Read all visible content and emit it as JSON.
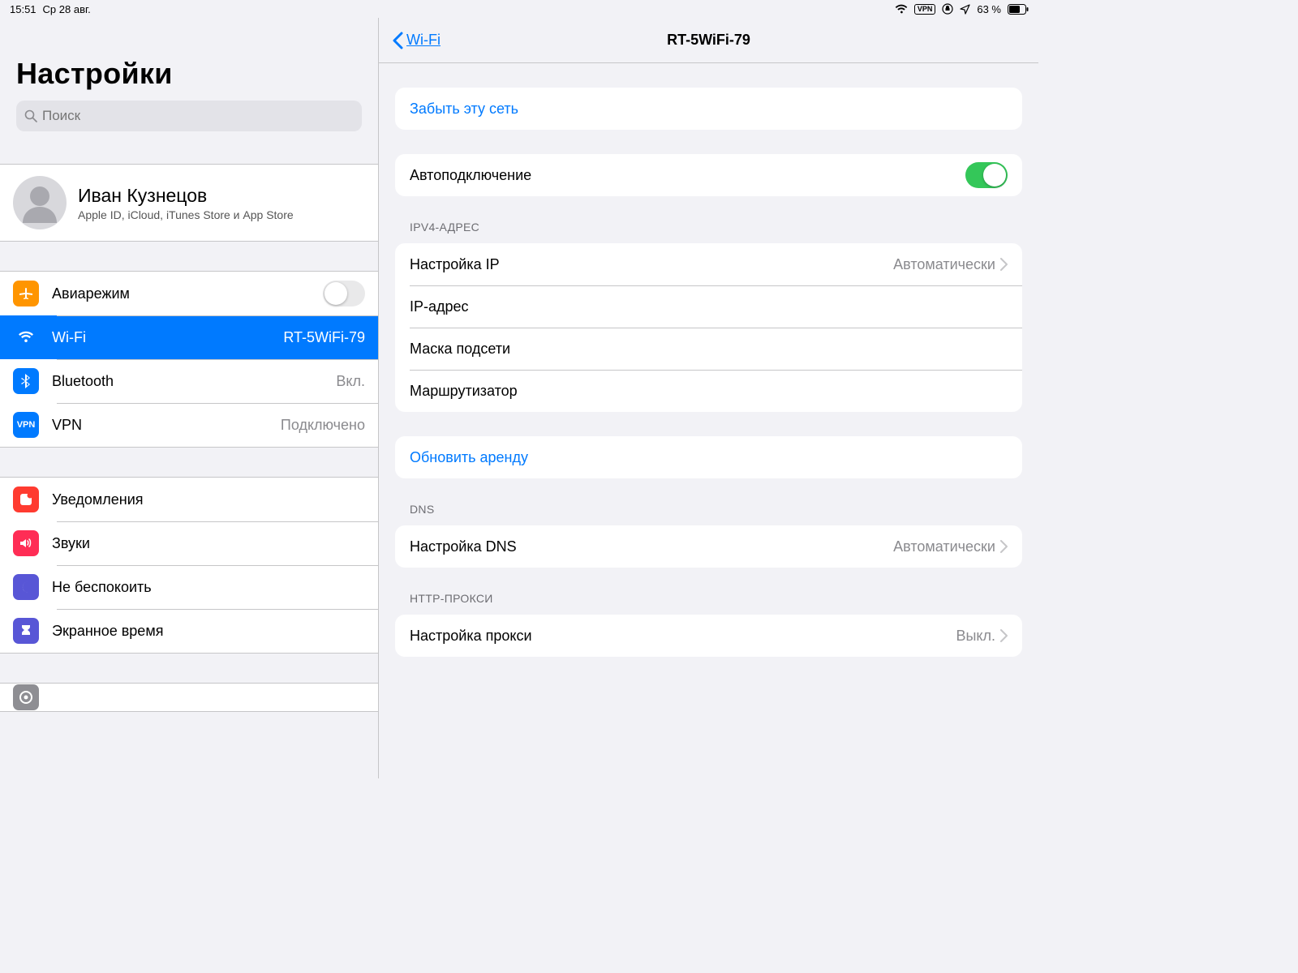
{
  "status": {
    "time": "15:51",
    "date": "Ср 28 авг.",
    "vpn": "VPN",
    "battery_pct": "63 %"
  },
  "sidebar": {
    "title": "Настройки",
    "search_placeholder": "Поиск",
    "profile": {
      "name": "Иван Кузнецов",
      "sub": "Apple ID, iCloud, iTunes Store и App Store"
    },
    "items1": {
      "airplane": {
        "label": "Авиарежим",
        "on": false
      },
      "wifi": {
        "label": "Wi-Fi",
        "value": "RT-5WiFi-79"
      },
      "bluetooth": {
        "label": "Bluetooth",
        "value": "Вкл."
      },
      "vpn": {
        "label": "VPN",
        "value": "Подключено"
      }
    },
    "items2": {
      "notifications": {
        "label": "Уведомления"
      },
      "sounds": {
        "label": "Звуки"
      },
      "dnd": {
        "label": "Не беспокоить"
      },
      "screentime": {
        "label": "Экранное время"
      }
    }
  },
  "main": {
    "back": "Wi-Fi",
    "title": "RT-5WiFi-79",
    "forget": "Забыть эту сеть",
    "autojoin": {
      "label": "Автоподключение",
      "on": true
    },
    "ipv4_header": "IPV4-АДРЕС",
    "ipv4": {
      "configure": {
        "label": "Настройка IP",
        "value": "Автоматически"
      },
      "ip": {
        "label": "IP-адрес",
        "value": ""
      },
      "mask": {
        "label": "Маска подсети",
        "value": ""
      },
      "router": {
        "label": "Маршрутизатор",
        "value": ""
      }
    },
    "renew": "Обновить аренду",
    "dns_header": "DNS",
    "dns": {
      "label": "Настройка DNS",
      "value": "Автоматически"
    },
    "proxy_header": "HTTP-ПРОКСИ",
    "proxy": {
      "label": "Настройка прокси",
      "value": "Выкл."
    }
  }
}
